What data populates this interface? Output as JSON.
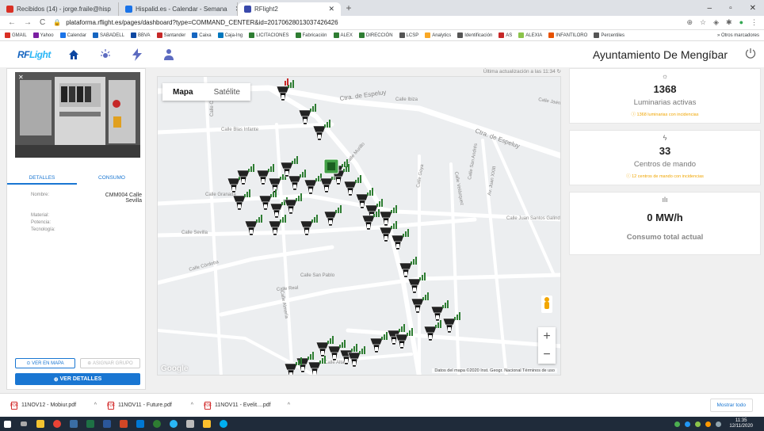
{
  "browser": {
    "tabs": [
      {
        "label": "Recibidos (14) - jorge.fraile@hisp",
        "color": "#d93025"
      },
      {
        "label": "Hispalid.es - Calendar - Semana",
        "color": "#1a73e8"
      },
      {
        "label": "RFlight2",
        "color": "#3949ab"
      }
    ],
    "url": "plataforma.rflight.es/pages/dashboard?type=COMMAND_CENTER&id=20170628013037426426",
    "bookmarks": [
      "GMAIL",
      "Yahoo",
      "Calendar",
      "SABADELL",
      "BBVA",
      "Santander",
      "Caixa",
      "Caja-Ing",
      "LICITACIONES",
      "Fabricación",
      "ALEX",
      "DIRECCIÓN",
      "LCSP",
      "Analytics",
      "Identificación",
      "AS",
      "ALEXIA",
      "INFANTILORO",
      "Percentiles"
    ],
    "bookmarks_other": "Otros marcadores"
  },
  "app": {
    "logo": "RF",
    "logo_accent": "Light",
    "municipality": "Ayuntamiento De Mengíbar"
  },
  "panel": {
    "tabs": [
      "DETALLES",
      "CONSUMO"
    ],
    "fields": [
      {
        "label": "Nombre:",
        "value": "CMM004 Calle Sevilla"
      },
      {
        "label": "Material:",
        "value": ""
      },
      {
        "label": "Potencia:",
        "value": ""
      },
      {
        "label": "Tecnología:",
        "value": ""
      }
    ],
    "btn_map": "VER EN MAPA",
    "btn_group": "ASIGNAR GRUPO",
    "btn_details": "VER DETALLES"
  },
  "map": {
    "last_update": "Última actualización a las 11:34",
    "type_map": "Mapa",
    "type_sat": "Satélite",
    "attribution": "Datos del mapa ©2020 Inst. Geogr. Nacional   Términos de uso",
    "google": "Google",
    "streets": [
      "Ctra. de Espeluy",
      "Ctra. de Espeluy",
      "Calle Blas Infante",
      "Calle Granada",
      "Calle Sevilla",
      "Calle Córdoba",
      "Calle Real",
      "Calle San Pablo",
      "Calle Juan Santos Galindo",
      "Calle Goya",
      "Av. Juan XXIII",
      "Calle Almería",
      "Calle Murillo",
      "Calle Velázquez",
      "Calle San Andrés",
      "Calle Jaén",
      "Calle Ibiza",
      "Calle Cádiz",
      "Calle Alta"
    ]
  },
  "stats": [
    {
      "icon": "lamp-icon",
      "value": "1368",
      "label": "Luminarias activas",
      "sub": "1368 luminarias con incidencias"
    },
    {
      "icon": "bolt-icon",
      "value": "33",
      "label": "Centros de mando",
      "sub": "12 centros de mando con incidencias"
    },
    {
      "icon": "bar-chart-icon",
      "value": "0 MW/h",
      "label": "Consumo total actual",
      "sub": ""
    }
  ],
  "downloads": [
    "11NOV12 - Mobiur.pdf",
    "11NOV11 - Future.pdf",
    "11NOV11 - Evelit....pdf"
  ],
  "downloads_showall": "Mostrar todo",
  "clock": {
    "time": "11:35",
    "date": "12/11/2020"
  },
  "colors": {
    "primary": "#1976d2",
    "warning": "#f0a500",
    "signal": "#2e7d32"
  }
}
